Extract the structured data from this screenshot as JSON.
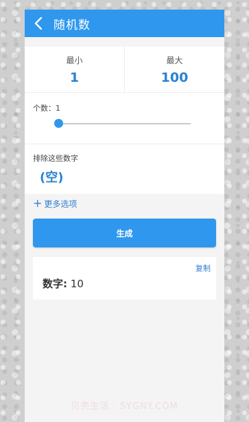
{
  "appbar": {
    "title": "随机数",
    "back_icon": "chevron-left-icon"
  },
  "range": {
    "min_label": "最小",
    "min_value": "1",
    "max_label": "最大",
    "max_value": "100"
  },
  "count": {
    "label": "个数：1",
    "slider_value": 1
  },
  "exclude": {
    "label": "排除这些数字",
    "value": "(空)"
  },
  "more": {
    "label": "更多选项",
    "icon": "plus-icon"
  },
  "generate_button": {
    "label": "生成"
  },
  "result": {
    "copy_label": "复制",
    "prefix": "数字:",
    "value": "10"
  },
  "watermark": {
    "text": "贝壳生活 · SYGNY.COM"
  },
  "colors": {
    "accent": "#2f97ee",
    "value_blue": "#2a82d2",
    "link_blue": "#2f7fd0"
  }
}
